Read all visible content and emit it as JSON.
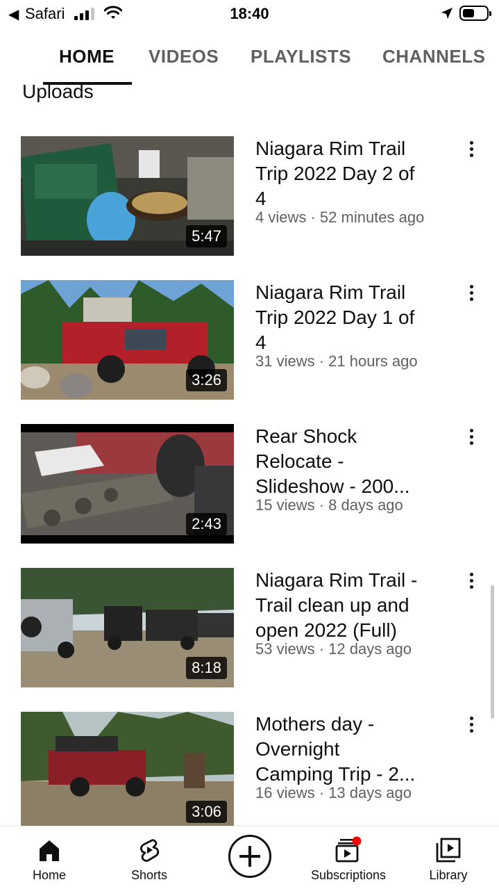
{
  "status_bar": {
    "back_arrow": "◀",
    "app": "Safari",
    "time": "18:40",
    "icons": [
      "cellular-signal-icon",
      "wifi-icon",
      "location-arrow-icon",
      "battery-icon"
    ]
  },
  "tabs": [
    {
      "label": "HOME",
      "active": true
    },
    {
      "label": "VIDEOS",
      "active": false
    },
    {
      "label": "PLAYLISTS",
      "active": false
    },
    {
      "label": "CHANNELS",
      "active": false
    }
  ],
  "section_title": "Uploads",
  "videos": [
    {
      "title_lines": [
        "Niagara Rim Trail",
        "Trip 2022 Day 2 of",
        "4"
      ],
      "meta": "4 views · 52 minutes ago",
      "duration": "5:47"
    },
    {
      "title_lines": [
        "Niagara Rim Trail",
        "Trip 2022 Day 1 of",
        "4"
      ],
      "meta": "31 views · 21 hours ago",
      "duration": "3:26"
    },
    {
      "title_lines": [
        "Rear Shock",
        "Relocate -",
        "Slideshow - 200..."
      ],
      "meta": "15 views · 8 days ago",
      "duration": "2:43"
    },
    {
      "title_lines": [
        "Niagara Rim Trail -",
        "Trail clean up and",
        "open 2022 (Full)"
      ],
      "meta": "53 views · 12 days ago",
      "duration": "8:18"
    },
    {
      "title_lines": [
        "Mothers day -",
        "Overnight",
        "Camping Trip - 2..."
      ],
      "meta": "16 views · 13 days ago",
      "duration": "3:06"
    }
  ],
  "bottom_nav": {
    "home": "Home",
    "shorts": "Shorts",
    "subscriptions": "Subscriptions",
    "library": "Library"
  },
  "colors": {
    "text_primary": "#0f0f0f",
    "text_secondary": "#606060",
    "notification_dot": "#ff0000"
  }
}
